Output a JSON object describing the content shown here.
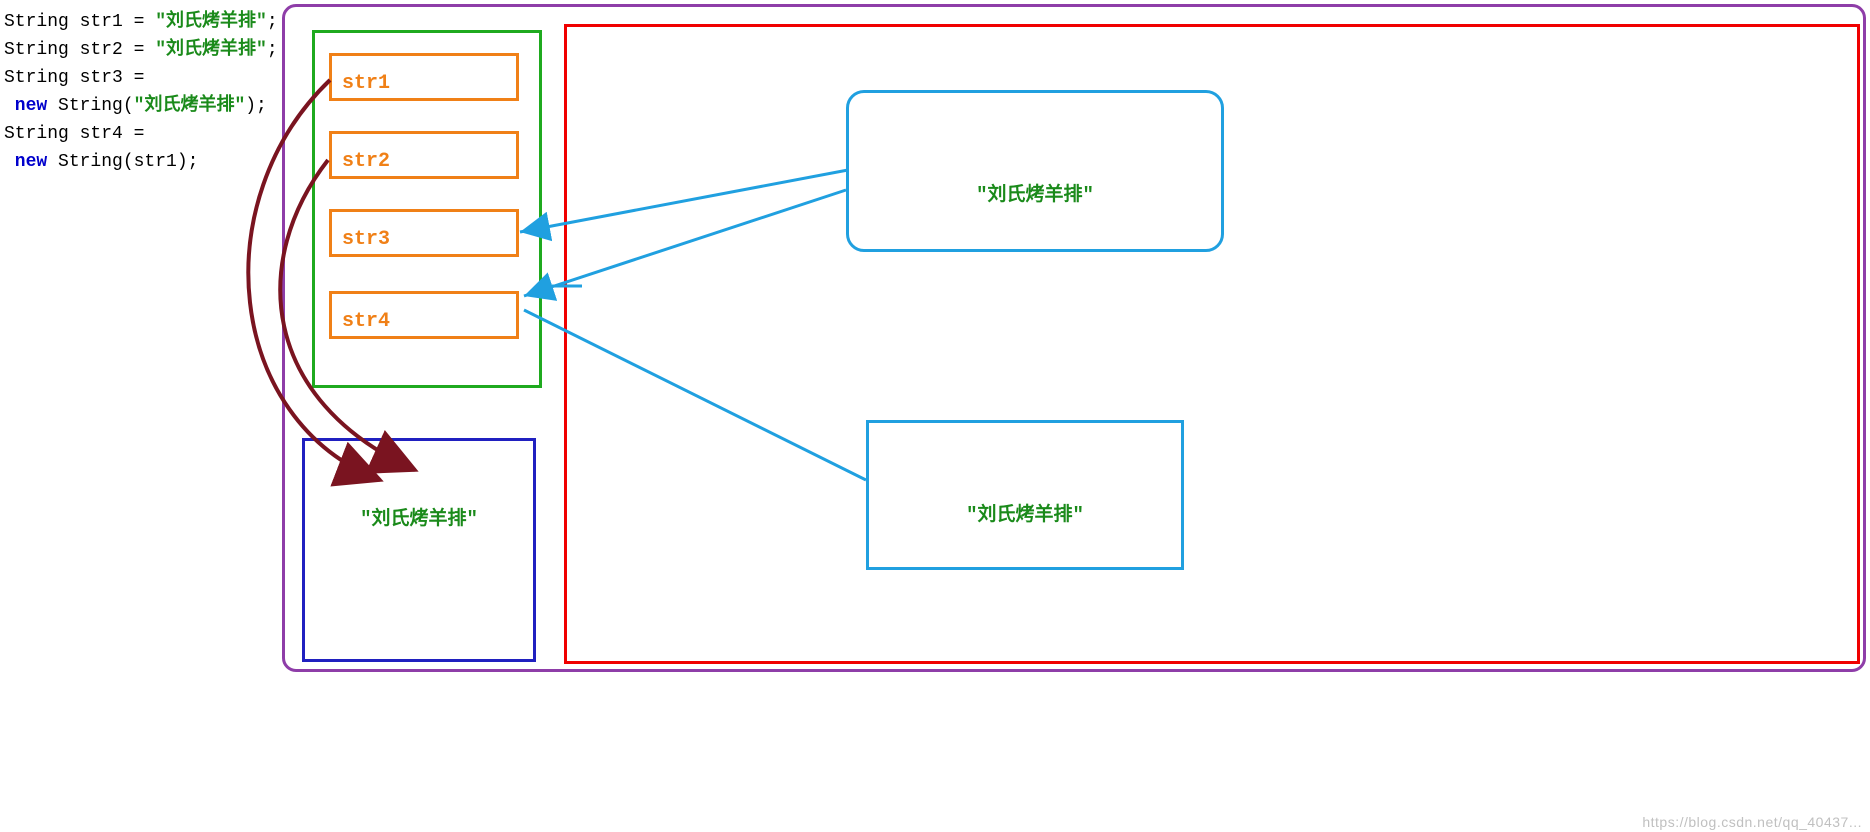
{
  "code": {
    "line1_type": "String",
    "line1_var": "str1",
    "line1_eq": " = ",
    "line1_val": "\"刘氏烤羊排\"",
    "line1_semi": ";",
    "line2_type": "String",
    "line2_var": "str2",
    "line2_eq": " = ",
    "line2_val": "\"刘氏烤羊排\"",
    "line2_semi": ";",
    "line3_type": "String",
    "line3_var": "str3",
    "line3_eq": " =",
    "line3_new": " new ",
    "line3_call": "String(",
    "line3_arg": "\"刘氏烤羊排\"",
    "line3_close": ");",
    "line4_type": "String",
    "line4_var": "str4",
    "line4_eq": " =",
    "line4_new": " new ",
    "line4_call": "String(str1);"
  },
  "stack": {
    "v1": "str1",
    "v2": "str2",
    "v3": "str3",
    "v4": "str4"
  },
  "pool": {
    "value": "\"刘氏烤羊排\""
  },
  "heap": {
    "obj1": "\"刘氏烤羊排\"",
    "obj2": "\"刘氏烤羊排\""
  },
  "watermark": "https://blog.csdn.net/qq_40437..."
}
